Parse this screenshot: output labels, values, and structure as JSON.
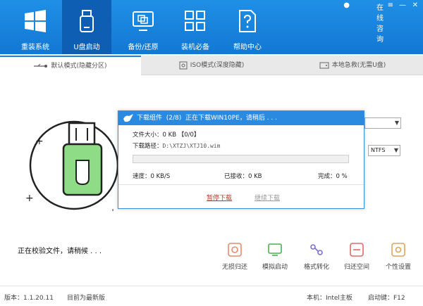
{
  "window": {
    "consult": "在线咨询",
    "min": "—",
    "close": "✕"
  },
  "nav": [
    {
      "label": "重装系统",
      "icon": "windows-logo-icon"
    },
    {
      "label": "U盘启动",
      "icon": "usb-drive-icon"
    },
    {
      "label": "备份/还原",
      "icon": "backup-restore-icon"
    },
    {
      "label": "装机必备",
      "icon": "apps-grid-icon"
    },
    {
      "label": "帮助中心",
      "icon": "help-document-icon"
    }
  ],
  "tabs": [
    {
      "label": "默认模式(隐藏分区)",
      "icon": "usb-icon"
    },
    {
      "label": "ISO模式(深度隐藏)",
      "icon": "disc-icon"
    },
    {
      "label": "本地急救(无需U盘)",
      "icon": "local-drive-icon"
    }
  ],
  "filesystem_select": "NTFS",
  "status_text": "正在校验文件，请稍候 . . .",
  "tools": [
    {
      "label": "无损归还",
      "icon": "restore-icon"
    },
    {
      "label": "模拟启动",
      "icon": "simulate-icon"
    },
    {
      "label": "格式转化",
      "icon": "convert-icon"
    },
    {
      "label": "归还空间",
      "icon": "space-icon"
    },
    {
      "label": "个性设置",
      "icon": "settings-icon"
    }
  ],
  "footer": {
    "version": "版本：1.1.20.11",
    "latest": "目前为最新版",
    "board": "本机：Intel主板",
    "hotkey": "启动键：F12"
  },
  "dialog": {
    "title": "下载组件",
    "count": "(2/8)",
    "status": "正在下载WIN10PE，请稍后 . . .",
    "size_label": "文件大小：",
    "size_value": "0 KB 【0/0】",
    "path_label": "下载路径：",
    "path_value": "D:\\XTZJ\\XTJ10.wim",
    "speed": "速度：0 KB/S",
    "received": "已接收：0 KB",
    "done": "完成：0 %",
    "progress": 0,
    "pause": "暂停下载",
    "resume": "继续下载"
  },
  "colors": {
    "accent": "#1a82dc",
    "illustration_green": "#8fdc86"
  }
}
